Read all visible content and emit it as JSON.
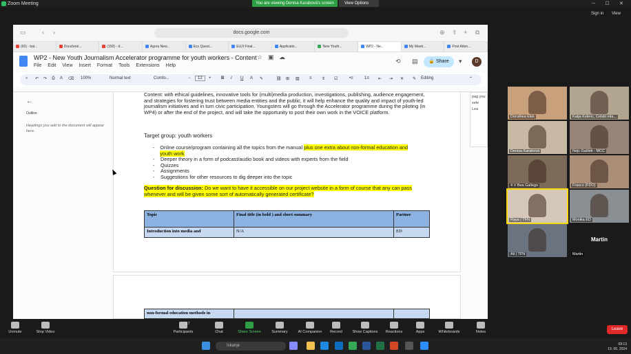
{
  "zoom": {
    "window_title": "Zoom Meeting",
    "share_banner": "You are viewing Denisa Karabová's screen",
    "view_options": "View Options",
    "sign_in": "Sign in",
    "view": "View"
  },
  "browser": {
    "url": "docs.google.com",
    "tabs": [
      {
        "label": "(60) - bal...",
        "color": "#ea4335"
      },
      {
        "label": "Doručené...",
        "color": "#ea4335"
      },
      {
        "label": "(150) - d...",
        "color": "#ea4335"
      },
      {
        "label": "Agora New...",
        "color": "#4285f4"
      },
      {
        "label": "Eco Quest...",
        "color": "#4285f4"
      },
      {
        "label": "EUJI Final...",
        "color": "#4285f4"
      },
      {
        "label": "Applicatio...",
        "color": "#4285f4"
      },
      {
        "label": "New Youth...",
        "color": "#34a853"
      },
      {
        "label": "WP2 - Ne...",
        "color": "#4285f4"
      },
      {
        "label": "My Meeti...",
        "color": "#4285f4"
      },
      {
        "label": "Post Atten...",
        "color": "#4285f4"
      }
    ]
  },
  "docs": {
    "title": "WP2 - New Youth Journalism Accelerator programme for youth workers - Content",
    "menu": [
      "File",
      "Edit",
      "View",
      "Insert",
      "Format",
      "Tools",
      "Extensions",
      "Help"
    ],
    "share_label": "Share",
    "avatar_letter": "D",
    "toolbar": {
      "zoom": "100%",
      "style": "Normal text",
      "font": "Comfo...",
      "font_size": "12",
      "mode": "Editing"
    },
    "outline_label": "Outline",
    "outline_hint": "Headings you add to the document will appear here.",
    "comment_snippet": "pag you sele Lea",
    "body": {
      "content_paragraph": "Content: with ethical guidelines, innovative tools for (multi)media production, investigations, publishing, audience engagement, and strategies for fostering trust between media entities and the public, it will help enhance the quality and impact of youth-led journalism initiatives and in turn civic participation. Youngsters will go through the Accelerator programme during the piloting (in WP4) or after the end of the project, and will take the opportunity to post their own work in the VOICE platform.",
      "target_label": "Target group",
      "target_value": ": youth workers",
      "bullet1_plain": "Online course/program containing all the topics from the manual ",
      "bullet1_hl": "plus one extra about non-formal education and youth work",
      "bullets": [
        "Deeper theory in a form of podcast/audio book and videos with experts from the field",
        "Quizzes",
        "Assignments",
        "Suggestions for other resources to dig deeper into the topic"
      ],
      "question_label": "Question for discussion:",
      "question_text": " Do we want to have it accessible on our project website in a form of course that any can pass whenever and will be given some sort of automatically generated certificate?",
      "table_headers": [
        "Topic",
        "Final title (in bold ) and short summary",
        "Partner"
      ],
      "table_row": [
        "Introduction into media and",
        "N/A",
        "ED"
      ],
      "page2_row": "non-formal education methods in"
    }
  },
  "gallery": [
    {
      "name": "Dorothea Elek"
    },
    {
      "name": "Katja Kolenc, Celski mla..."
    },
    {
      "name": "Denisa Karabová"
    },
    {
      "name": "Nejc Gašlek - MCC"
    },
    {
      "name": "4 V Bea Gallego"
    },
    {
      "name": "Frasco (FDO)"
    },
    {
      "name": "Raya | TFN"
    },
    {
      "name": "Monika ED"
    },
    {
      "name": "Ali | TFN"
    },
    {
      "name": "Martin",
      "big": "Martin"
    }
  ],
  "controls": [
    {
      "label": "Unmute"
    },
    {
      "label": "Stop Video"
    },
    {
      "label": "Participants",
      "badge": "17"
    },
    {
      "label": "Chat"
    },
    {
      "label": "Share Screen"
    },
    {
      "label": "Summary"
    },
    {
      "label": "AI Companion"
    },
    {
      "label": "Record"
    },
    {
      "label": "Show Captions"
    },
    {
      "label": "Reactions"
    },
    {
      "label": "Apps"
    },
    {
      "label": "Whiteboards"
    },
    {
      "label": "Notes"
    }
  ],
  "leave_label": "Leave",
  "taskbar": {
    "search_placeholder": "Iskanje",
    "time": "09:13",
    "date": "19. 06. 2024"
  },
  "colors": {
    "share_green": "#2e9e44",
    "leave_red": "#e02828",
    "table_header": "#8db3e2",
    "table_row": "#c6d9f1",
    "highlight": "#ffff00"
  }
}
